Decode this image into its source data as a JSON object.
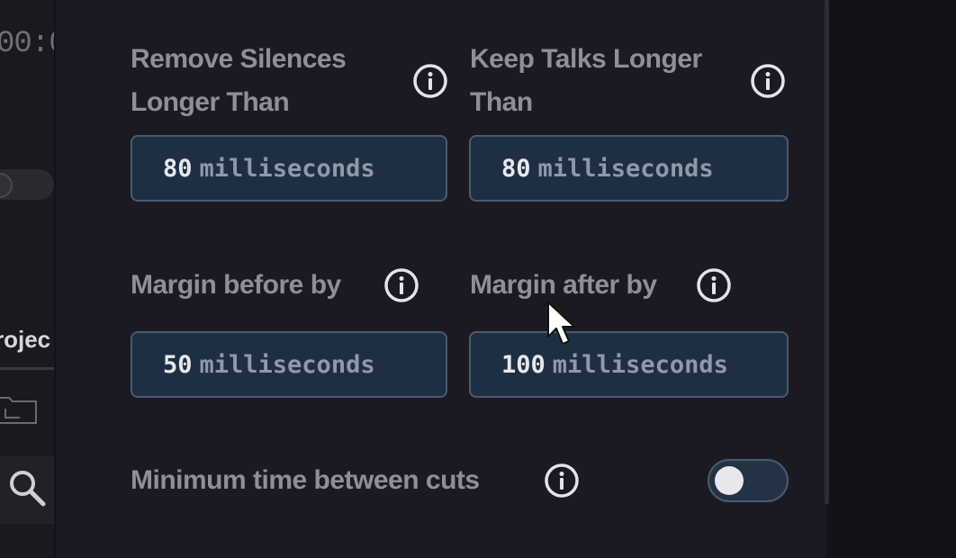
{
  "host_app": {
    "timecode_fragment": "00:0",
    "project_tab_fragment": "rojec"
  },
  "settings": {
    "remove_silences": {
      "label_line1": "Remove Silences",
      "label_line2": "Longer Than",
      "value": "80",
      "unit": "milliseconds"
    },
    "keep_talks": {
      "label_line1": "Keep Talks Longer",
      "label_line2": "Than",
      "value": "80",
      "unit": "milliseconds"
    },
    "margin_before": {
      "label": "Margin before by",
      "value": "50",
      "unit": "milliseconds"
    },
    "margin_after": {
      "label": "Margin after by",
      "value": "100",
      "unit": "milliseconds"
    },
    "min_time_between_cuts": {
      "label": "Minimum time between cuts",
      "enabled": false
    }
  },
  "icons": {
    "info": "info-icon",
    "search": "search-icon",
    "folder": "folder-icon",
    "cursor": "mouse-pointer-icon"
  },
  "colors": {
    "panel_bg": "#1b1a23",
    "input_bg": "#1e2f44",
    "input_border": "#4b5a6d",
    "label_text": "#8d8f9a"
  }
}
